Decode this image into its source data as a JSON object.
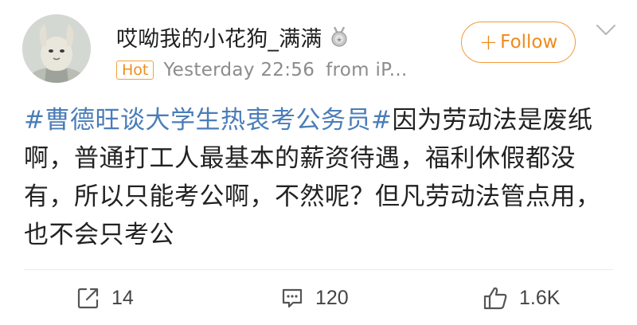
{
  "author": {
    "username": "哎呦我的小花狗_满满",
    "badge_icon": "medal-icon"
  },
  "meta": {
    "hot_label": "Hot",
    "time": "Yesterday 22:56",
    "source": "from iP..."
  },
  "follow": {
    "label": "Follow",
    "icon": "plus-icon"
  },
  "menu_icon": "chevron-down-icon",
  "post": {
    "hashtag": "#曹德旺谈大学生热衷考公务员#",
    "text": "因为劳动法是废纸啊，普通打工人最基本的薪资待遇，福利休假都没有，所以只能考公啊，不然呢？但凡劳动法管点用，也不会只考公"
  },
  "actions": {
    "repost_count": "14",
    "comment_count": "120",
    "like_count": "1.6K"
  },
  "colors": {
    "accent": "#f08a1a",
    "hashtag": "#4a7db8",
    "hot_badge": "#ef8e1c",
    "meta_text": "#8c8c8c"
  }
}
